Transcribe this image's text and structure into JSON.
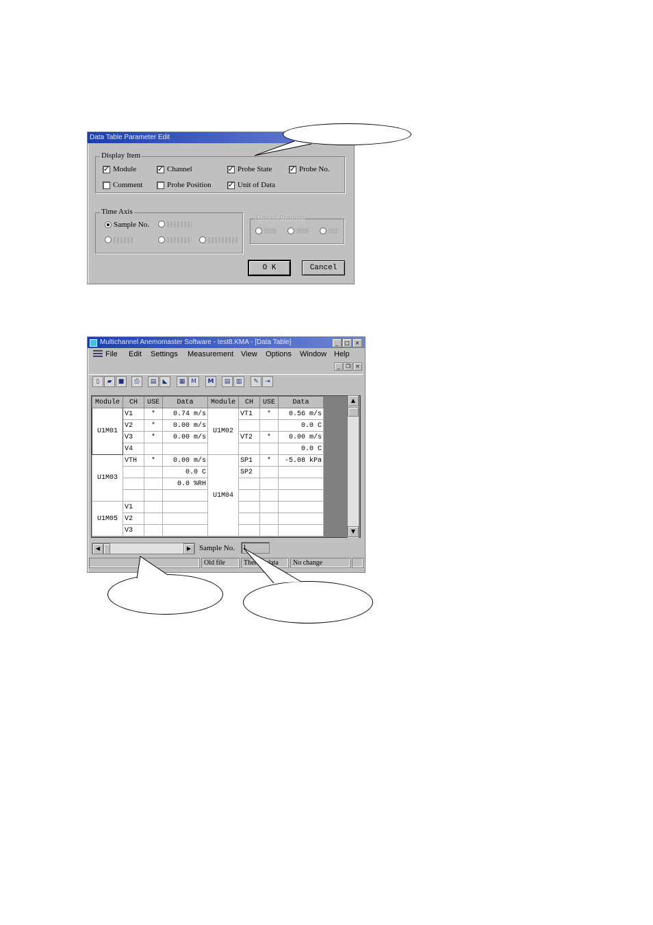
{
  "dialog": {
    "title": "Data Table Parameter Edit",
    "display_item": {
      "title": "Display Item",
      "items": [
        {
          "label": "Module",
          "checked": true
        },
        {
          "label": "Channel",
          "checked": true
        },
        {
          "label": "Probe State",
          "checked": true
        },
        {
          "label": "Probe No.",
          "checked": true
        },
        {
          "label": "Comment",
          "checked": false
        },
        {
          "label": "Probe Position",
          "checked": false
        },
        {
          "label": "Unit of Data",
          "checked": true
        }
      ]
    },
    "time_axis": {
      "title": "Time Axis",
      "sample_no": "Sample No.",
      "radios": [
        "Sample No.",
        "",
        "",
        "",
        ""
      ]
    },
    "unit_of_position": {
      "title": "Unit of Position"
    },
    "ok_label": "O K",
    "cancel_label": "Cancel"
  },
  "app": {
    "title": "Multichannel Anemomaster Software - test8.KMA - [Data Table]",
    "menu": [
      "File",
      "Edit",
      "Settings",
      "Measurement",
      "View",
      "Options",
      "Window",
      "Help"
    ],
    "headers": [
      "Module",
      "CH",
      "USE",
      "Data",
      "Module",
      "CH",
      "USE",
      "Data"
    ],
    "rows": [
      [
        "U1M01",
        "V1",
        "*",
        "0.74 m/s",
        "U1M02",
        "VT1",
        "*",
        "0.56 m/s"
      ],
      [
        "",
        "V2",
        "*",
        "0.00 m/s",
        "",
        "",
        "",
        "0.0 C"
      ],
      [
        "",
        "V3",
        "*",
        "0.00 m/s",
        "",
        "VT2",
        "*",
        "0.00 m/s"
      ],
      [
        "",
        "V4",
        "",
        "",
        "",
        "",
        "",
        "0.0 C"
      ],
      [
        "U1M03",
        "VTH",
        "*",
        "0.00 m/s",
        "U1M04",
        "SP1",
        "*",
        "-5.08 kPa"
      ],
      [
        "",
        "",
        "",
        "0.0 C",
        "",
        "SP2",
        "",
        ""
      ],
      [
        "",
        "",
        "",
        "0.0 %RH",
        "",
        "",
        "",
        ""
      ],
      [
        "",
        "",
        "",
        "",
        "",
        "",
        "",
        ""
      ],
      [
        "U1M05",
        "V1",
        "",
        "",
        "",
        "",
        "",
        ""
      ],
      [
        "",
        "V2",
        "",
        "",
        "",
        "",
        "",
        ""
      ],
      [
        "",
        "V3",
        "",
        "",
        "",
        "",
        "",
        ""
      ]
    ],
    "sample_no_label": "Sample No.",
    "sample_no_value": "1",
    "status": [
      "",
      "Old file",
      "Thermo data",
      "No change"
    ]
  }
}
